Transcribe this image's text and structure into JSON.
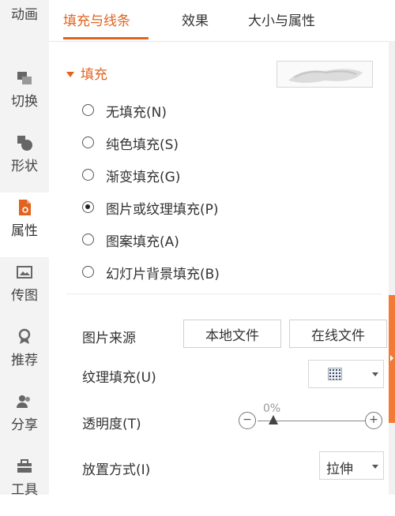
{
  "sidebar": {
    "items": [
      {
        "label": "动画",
        "icon": "animation-icon"
      },
      {
        "label": "切换",
        "icon": "transition-icon"
      },
      {
        "label": "形状",
        "icon": "shape-icon"
      },
      {
        "label": "属性",
        "icon": "property-icon",
        "active": true
      },
      {
        "label": "传图",
        "icon": "upload-image-icon"
      },
      {
        "label": "推荐",
        "icon": "recommend-icon"
      },
      {
        "label": "分享",
        "icon": "share-icon"
      },
      {
        "label": "工具",
        "icon": "toolbox-icon"
      }
    ]
  },
  "tabs": [
    {
      "label": "填充与线条",
      "active": true
    },
    {
      "label": "效果"
    },
    {
      "label": "大小与属性"
    }
  ],
  "fill": {
    "section_title": "填充",
    "options": [
      {
        "label": "无填充(N)",
        "selected": false
      },
      {
        "label": "纯色填充(S)",
        "selected": false
      },
      {
        "label": "渐变填充(G)",
        "selected": false
      },
      {
        "label": "图片或纹理填充(P)",
        "selected": true
      },
      {
        "label": "图案填充(A)",
        "selected": false
      },
      {
        "label": "幻灯片背景填充(B)",
        "selected": false
      }
    ]
  },
  "picture_source": {
    "label": "图片来源",
    "local_button": "本地文件",
    "online_button": "在线文件"
  },
  "texture": {
    "label": "纹理填充(U)"
  },
  "transparency": {
    "label": "透明度(T)",
    "value": "0%",
    "minus": "−",
    "plus": "+"
  },
  "placement": {
    "label": "放置方式(I)",
    "value": "拉伸"
  },
  "colors": {
    "accent": "#e0631f",
    "handle": "#f07a36",
    "sidebar_bg": "#f3f3f3"
  }
}
